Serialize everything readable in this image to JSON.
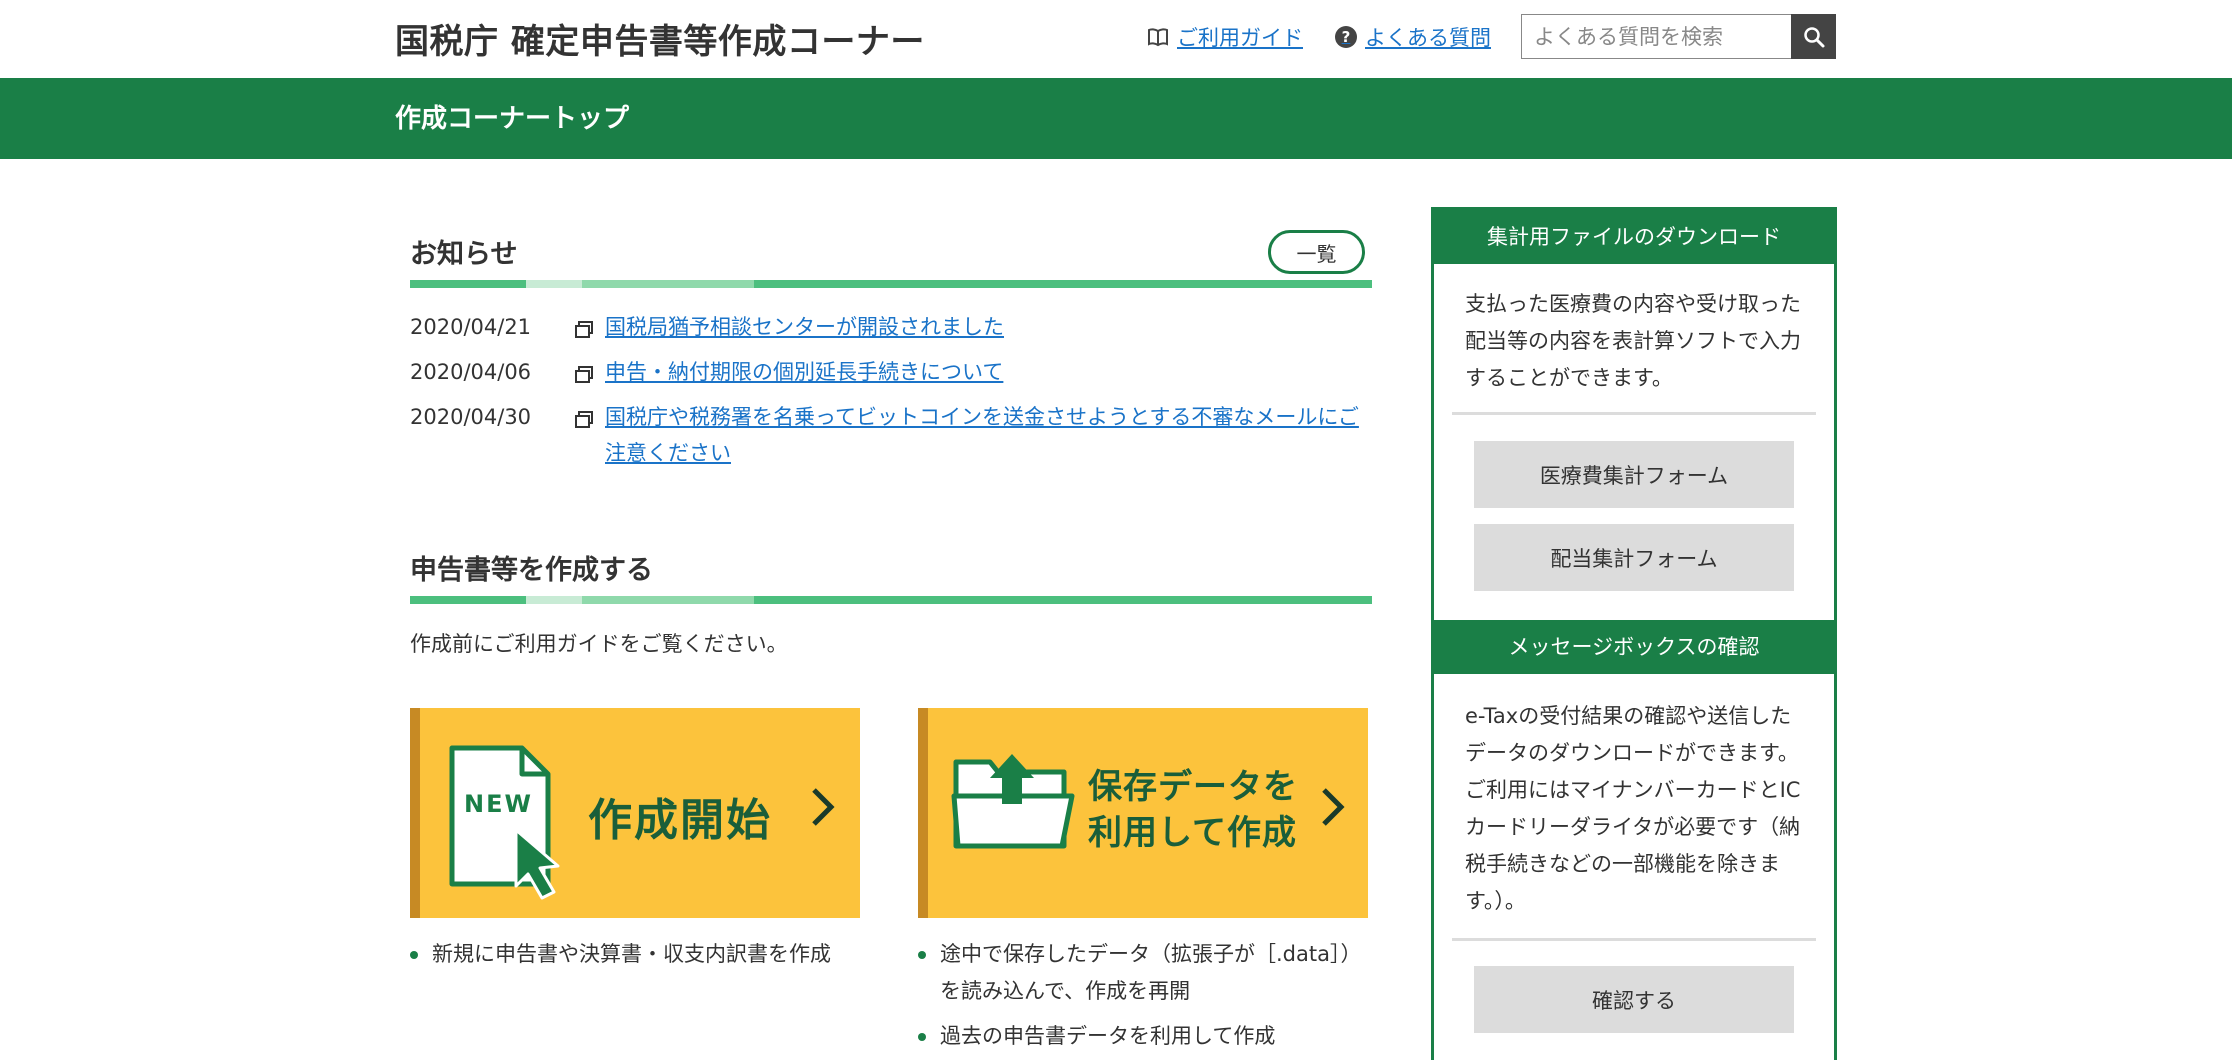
{
  "header": {
    "title": "国税庁 確定申告書等作成コーナー",
    "guide_label": "ご利用ガイド",
    "faq_label": "よくある質問",
    "faq_icon_glyph": "?",
    "search_placeholder": "よくある質問を検索"
  },
  "nav": {
    "title": "作成コーナートップ"
  },
  "news": {
    "title": "お知らせ",
    "list_button": "一覧",
    "items": [
      {
        "date": "2020/04/21",
        "text": "国税局猶予相談センターが開設されました"
      },
      {
        "date": "2020/04/06",
        "text": "申告・納付期限の個別延長手続きについて"
      },
      {
        "date": "2020/04/30",
        "text": "国税庁や税務署を名乗ってビットコインを送金させようとする不審なメールにご注意ください"
      }
    ]
  },
  "create": {
    "title": "申告書等を作成する",
    "intro": "作成前にご利用ガイドをご覧ください。",
    "new_card": {
      "badge": "NEW",
      "label": "作成開始",
      "bullets": [
        "新規に申告書や決算書・収支内訳書を作成"
      ]
    },
    "load_card": {
      "label": "保存データを\n利用して作成",
      "bullets": [
        "途中で保存したデータ（拡張子が［.data］）を読み込んで、作成を再開",
        "過去の申告書データを利用して作成"
      ]
    }
  },
  "sidebar": {
    "download": {
      "title": "集計用ファイルのダウンロード",
      "text": "支払った医療費の内容や受け取った配当等の内容を表計算ソフトで入力することができます。",
      "button1": "医療費集計フォーム",
      "button2": "配当集計フォーム"
    },
    "message": {
      "title": "メッセージボックスの確認",
      "text": "e-Taxの受付結果の確認や送信したデータのダウンロードができます。ご利用にはマイナンバーカードとICカードリーダライタが必要です（納税手続きなどの一部機能を除きます。）。",
      "button": "確認する"
    }
  },
  "colors": {
    "brand_green": "#1a7f47",
    "card_yellow": "#fcc33c",
    "link_blue": "#1a73c8"
  }
}
